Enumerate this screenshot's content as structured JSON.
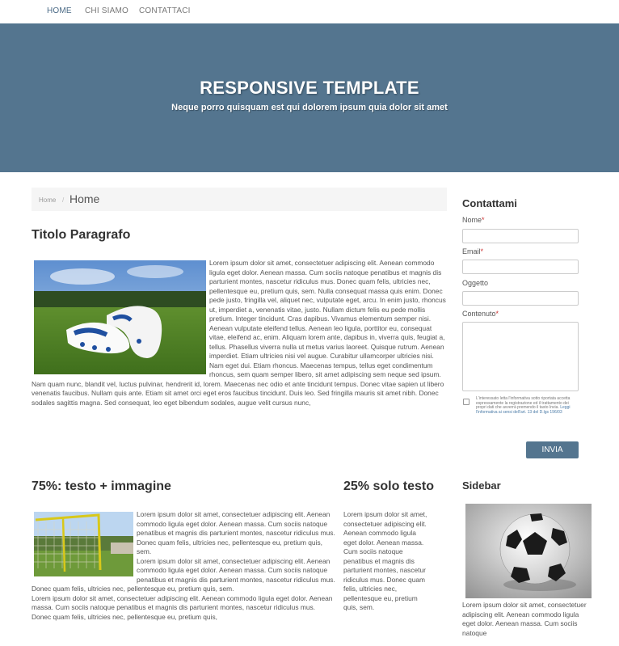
{
  "nav": {
    "items": [
      "HOME",
      "CHI SIAMO",
      "CONTATTACI"
    ]
  },
  "hero": {
    "title": "RESPONSIVE TEMPLATE",
    "subtitle": "Neque porro quisquam est qui dolorem ipsum quia dolor sit amet"
  },
  "breadcrumb": {
    "home": "Home",
    "separator": "/",
    "current": "Home"
  },
  "section1": {
    "title": "Titolo Paragrafo",
    "image_name": "football-boots-image",
    "body": "Lorem ipsum dolor sit amet, consectetuer adipiscing elit. Aenean commodo ligula eget dolor. Aenean massa. Cum sociis natoque penatibus et magnis dis parturient montes, nascetur ridiculus mus. Donec quam felis, ultricies nec, pellentesque eu, pretium quis, sem. Nulla consequat massa quis enim. Donec pede justo, fringilla vel, aliquet nec, vulputate eget, arcu. In enim justo, rhoncus ut, imperdiet a, venenatis vitae, justo. Nullam dictum felis eu pede mollis pretium. Integer tincidunt. Cras dapibus. Vivamus elementum semper nisi. Aenean vulputate eleifend tellus. Aenean leo ligula, porttitor eu, consequat vitae, eleifend ac, enim. Aliquam lorem ante, dapibus in, viverra quis, feugiat a, tellus. Phasellus viverra nulla ut metus varius laoreet. Quisque rutrum. Aenean imperdiet. Etiam ultricies nisi vel augue. Curabitur ullamcorper ultricies nisi. Nam eget dui. Etiam rhoncus. Maecenas tempus, tellus eget condimentum rhoncus, sem quam semper libero, sit amet adipiscing sem neque sed ipsum. Nam quam nunc, blandit vel, luctus pulvinar, hendrerit id, lorem. Maecenas nec odio et ante tincidunt tempus. Donec vitae sapien ut libero venenatis faucibus. Nullam quis ante. Etiam sit amet orci eget eros faucibus tincidunt. Duis leo. Sed fringilla mauris sit amet nibh. Donec sodales sagittis magna. Sed consequat, leo eget bibendum sodales, augue velit cursus nunc,"
  },
  "contact": {
    "title": "Contattami",
    "fields": {
      "name": "Nome",
      "email": "Email",
      "subject": "Oggetto",
      "content": "Contenuto"
    },
    "required_mark": "*",
    "privacy_text": "L'interessato letta l'informativa sotto riportata accetta espressamente la registrazione ed il trattamento dei propri dati che avverrà premendo il tasto Invia.",
    "privacy_link": "Leggi l'informativa ai sensi dell'art. 13 del D.lgs 196/03",
    "submit": "INVIA"
  },
  "section2": {
    "title": "75%: testo + immagine",
    "image_name": "soccer-goal-image",
    "body1": "Lorem ipsum dolor sit amet, consectetuer adipiscing elit. Aenean commodo ligula eget dolor. Aenean massa. Cum sociis natoque penatibus et magnis dis parturient montes, nascetur ridiculus mus. Donec quam felis, ultricies nec, pellentesque eu, pretium quis, sem.",
    "body2": "Lorem ipsum dolor sit amet, consectetuer adipiscing elit. Aenean commodo ligula eget dolor. Aenean massa. Cum sociis natoque penatibus et magnis dis parturient montes, nascetur ridiculus mus. Donec quam felis, ultricies nec, pellentesque eu, pretium quis, sem.",
    "body3": "Lorem ipsum dolor sit amet, consectetuer adipiscing elit. Aenean commodo ligula eget dolor. Aenean massa. Cum sociis natoque penatibus et magnis dis parturient montes, nascetur ridiculus mus. Donec quam felis, ultricies nec, pellentesque eu, pretium quis,"
  },
  "section3": {
    "title": "25% solo testo",
    "body": "Lorem ipsum dolor sit amet, consectetuer adipiscing elit. Aenean commodo ligula eget dolor. Aenean massa. Cum sociis natoque penatibus et magnis dis parturient montes, nascetur ridiculus mus. Donec quam felis, ultricies nec, pellentesque eu, pretium quis, sem."
  },
  "sidebar": {
    "title": "Sidebar",
    "image_name": "soccer-ball-image",
    "body": "Lorem ipsum dolor sit amet, consectetuer adipiscing elit. Aenean commodo ligula eget dolor. Aenean massa. Cum sociis natoque"
  }
}
